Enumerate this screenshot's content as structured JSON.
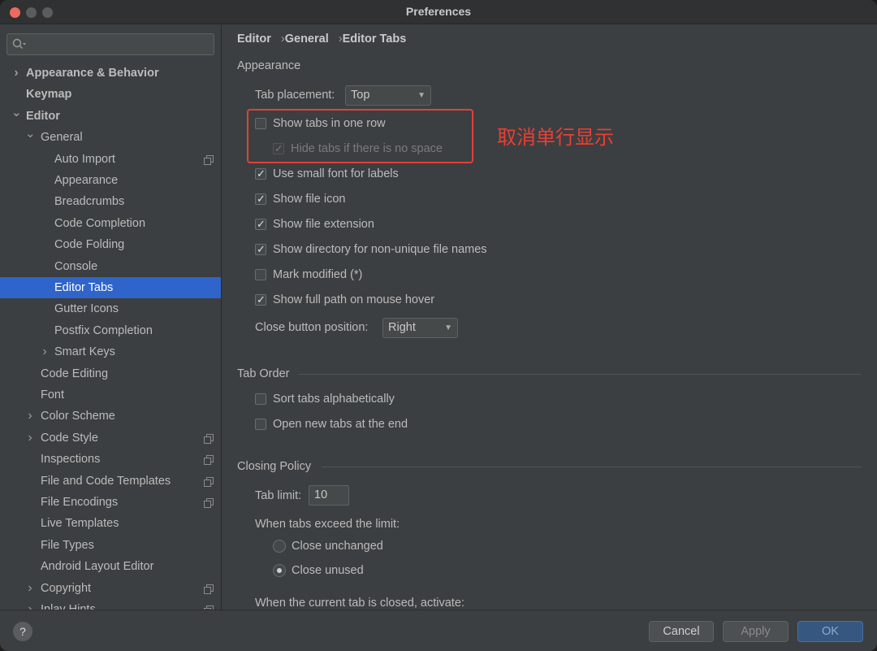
{
  "window": {
    "title": "Preferences"
  },
  "sidebar": {
    "search_placeholder": "",
    "items": [
      {
        "label": "Appearance & Behavior",
        "level": 0,
        "arrow": "right",
        "bold": true,
        "copy": false,
        "selected": false
      },
      {
        "label": "Keymap",
        "level": 0,
        "arrow": "",
        "bold": true,
        "copy": false,
        "selected": false
      },
      {
        "label": "Editor",
        "level": 0,
        "arrow": "down",
        "bold": true,
        "copy": false,
        "selected": false
      },
      {
        "label": "General",
        "level": 1,
        "arrow": "down",
        "bold": false,
        "copy": false,
        "selected": false
      },
      {
        "label": "Auto Import",
        "level": 2,
        "arrow": "",
        "bold": false,
        "copy": true,
        "selected": false
      },
      {
        "label": "Appearance",
        "level": 2,
        "arrow": "",
        "bold": false,
        "copy": false,
        "selected": false
      },
      {
        "label": "Breadcrumbs",
        "level": 2,
        "arrow": "",
        "bold": false,
        "copy": false,
        "selected": false
      },
      {
        "label": "Code Completion",
        "level": 2,
        "arrow": "",
        "bold": false,
        "copy": false,
        "selected": false
      },
      {
        "label": "Code Folding",
        "level": 2,
        "arrow": "",
        "bold": false,
        "copy": false,
        "selected": false
      },
      {
        "label": "Console",
        "level": 2,
        "arrow": "",
        "bold": false,
        "copy": false,
        "selected": false
      },
      {
        "label": "Editor Tabs",
        "level": 2,
        "arrow": "",
        "bold": false,
        "copy": false,
        "selected": true
      },
      {
        "label": "Gutter Icons",
        "level": 2,
        "arrow": "",
        "bold": false,
        "copy": false,
        "selected": false
      },
      {
        "label": "Postfix Completion",
        "level": 2,
        "arrow": "",
        "bold": false,
        "copy": false,
        "selected": false
      },
      {
        "label": "Smart Keys",
        "level": 2,
        "arrow": "right",
        "bold": false,
        "copy": false,
        "selected": false
      },
      {
        "label": "Code Editing",
        "level": 1,
        "arrow": "",
        "bold": false,
        "copy": false,
        "selected": false
      },
      {
        "label": "Font",
        "level": 1,
        "arrow": "",
        "bold": false,
        "copy": false,
        "selected": false
      },
      {
        "label": "Color Scheme",
        "level": 1,
        "arrow": "right",
        "bold": false,
        "copy": false,
        "selected": false
      },
      {
        "label": "Code Style",
        "level": 1,
        "arrow": "right",
        "bold": false,
        "copy": true,
        "selected": false
      },
      {
        "label": "Inspections",
        "level": 1,
        "arrow": "",
        "bold": false,
        "copy": true,
        "selected": false
      },
      {
        "label": "File and Code Templates",
        "level": 1,
        "arrow": "",
        "bold": false,
        "copy": true,
        "selected": false
      },
      {
        "label": "File Encodings",
        "level": 1,
        "arrow": "",
        "bold": false,
        "copy": true,
        "selected": false
      },
      {
        "label": "Live Templates",
        "level": 1,
        "arrow": "",
        "bold": false,
        "copy": false,
        "selected": false
      },
      {
        "label": "File Types",
        "level": 1,
        "arrow": "",
        "bold": false,
        "copy": false,
        "selected": false
      },
      {
        "label": "Android Layout Editor",
        "level": 1,
        "arrow": "",
        "bold": false,
        "copy": false,
        "selected": false
      },
      {
        "label": "Copyright",
        "level": 1,
        "arrow": "right",
        "bold": false,
        "copy": true,
        "selected": false
      },
      {
        "label": "Inlay Hints",
        "level": 1,
        "arrow": "right",
        "bold": false,
        "copy": true,
        "selected": false
      }
    ]
  },
  "breadcrumb": [
    "Editor",
    "General",
    "Editor Tabs"
  ],
  "appearance": {
    "section_title": "Appearance",
    "tab_placement_label": "Tab placement:",
    "tab_placement_value": "Top",
    "options": [
      {
        "label": "Show tabs in one row",
        "checked": false,
        "disabled": false
      },
      {
        "label": "Hide tabs if there is no space",
        "checked": true,
        "disabled": true
      },
      {
        "label": "Use small font for labels",
        "checked": true,
        "disabled": false
      },
      {
        "label": "Show file icon",
        "checked": true,
        "disabled": false
      },
      {
        "label": "Show file extension",
        "checked": true,
        "disabled": false
      },
      {
        "label": "Show directory for non-unique file names",
        "checked": true,
        "disabled": false
      },
      {
        "label": "Mark modified (*)",
        "checked": false,
        "disabled": false
      },
      {
        "label": "Show full path on mouse hover",
        "checked": true,
        "disabled": false
      }
    ],
    "close_button_label": "Close button position:",
    "close_button_value": "Right"
  },
  "annotation": {
    "text": "取消单行显示",
    "color": "#ec3e33"
  },
  "tab_order": {
    "section_title": "Tab Order",
    "options": [
      {
        "label": "Sort tabs alphabetically",
        "checked": false
      },
      {
        "label": "Open new tabs at the end",
        "checked": false
      }
    ]
  },
  "closing_policy": {
    "section_title": "Closing Policy",
    "tab_limit_label": "Tab limit:",
    "tab_limit_value": "10",
    "exceed_label": "When tabs exceed the limit:",
    "radios": [
      {
        "label": "Close unchanged",
        "selected": false
      },
      {
        "label": "Close unused",
        "selected": true
      }
    ],
    "current_closed_label": "When the current tab is closed, activate:"
  },
  "buttons": {
    "help": "?",
    "cancel": "Cancel",
    "apply": "Apply",
    "ok": "OK"
  },
  "colors": {
    "selection": "#2f65ca",
    "highlight_border": "#e0413a",
    "close_button": "#ed6a5e"
  }
}
